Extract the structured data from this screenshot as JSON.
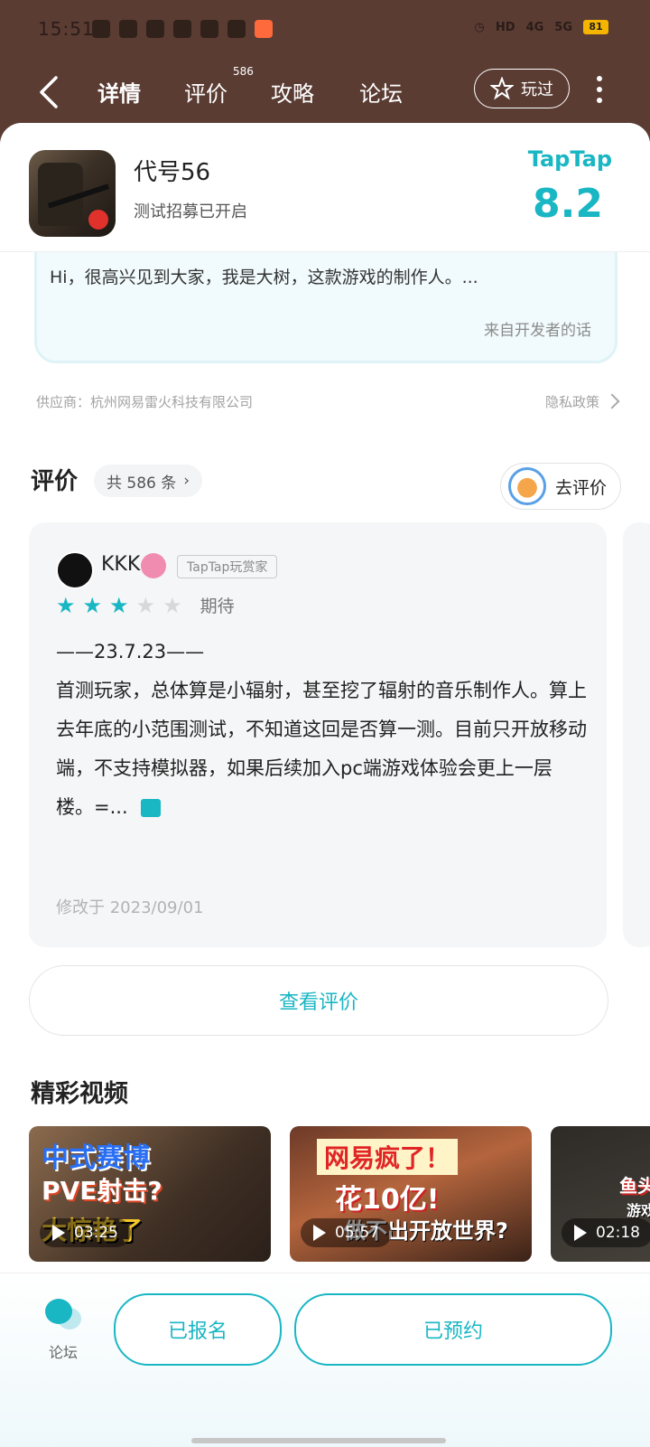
{
  "status": {
    "time": "15:51",
    "battery": "81"
  },
  "nav": {
    "tabs": [
      {
        "label": "详情"
      },
      {
        "label": "评价",
        "badge": "586"
      },
      {
        "label": "攻略"
      },
      {
        "label": "论坛"
      }
    ],
    "played_label": "玩过"
  },
  "game": {
    "title": "代号56",
    "subtitle": "测试招募已开启",
    "platform": "TapTap",
    "score": "8.2"
  },
  "developer_card": {
    "text": "Hi，很高兴见到大家，我是大树，这款游戏的制作人。...",
    "source": "来自开发者的话"
  },
  "provider": "供应商：杭州网易雷火科技有限公司",
  "privacy": "隐私政策",
  "reviews": {
    "title": "评价",
    "count_label": "共 586 条",
    "go_review_label": "去评价",
    "item": {
      "user": "KKK",
      "tag": "TapTap玩赏家",
      "rating": 3,
      "rating_label": "期待",
      "body_line1": "——23.7.23——",
      "body": "首测玩家，总体算是小辐射，甚至挖了辐射的音乐制作人。算上去年底的小范围测试，不知道这回是否算一测。目前只开放移动端，不支持模拟器，如果后续加入pc端游戏体验会更上一层楼。=...",
      "date": "修改于 2023/09/01"
    },
    "view_button": "查看评价"
  },
  "videos": {
    "title": "精彩视频",
    "items": [
      {
        "line1": "中式赛博",
        "line2": "PVE射击?",
        "line3": "大惊艳了",
        "duration": "03:25"
      },
      {
        "line1": "网易疯了！",
        "line2": "花10亿!",
        "line3": "做不出开放世界?",
        "duration": "05:57"
      },
      {
        "line1": "鱼头",
        "line2": "游戏",
        "line3": "",
        "duration": "02:18"
      }
    ]
  },
  "bottom": {
    "forum_label": "论坛",
    "enroll_label": "已报名",
    "reserve_label": "已预约"
  },
  "colors": {
    "accent": "#19b6c4",
    "header_bg": "#5a3c33"
  }
}
